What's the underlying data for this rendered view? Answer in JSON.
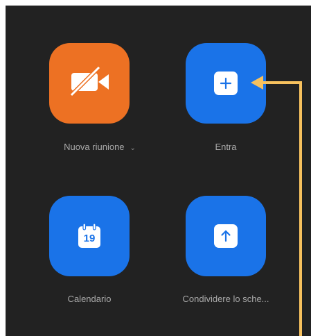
{
  "tiles": {
    "new_meeting": {
      "label": "Nuova riunione",
      "icon": "video-off-icon",
      "color": "#ED7123"
    },
    "join": {
      "label": "Entra",
      "icon": "plus-icon",
      "color": "#1A73E8"
    },
    "schedule": {
      "label": "Calendario",
      "icon": "calendar-icon",
      "date_number": "19",
      "color": "#1A73E8"
    },
    "share_screen": {
      "label": "Condividere lo sche...",
      "icon": "arrow-up-icon",
      "color": "#1A73E8"
    }
  },
  "annotation": {
    "icon": "arrow-annotation-icon",
    "color": "#F7C15E"
  }
}
